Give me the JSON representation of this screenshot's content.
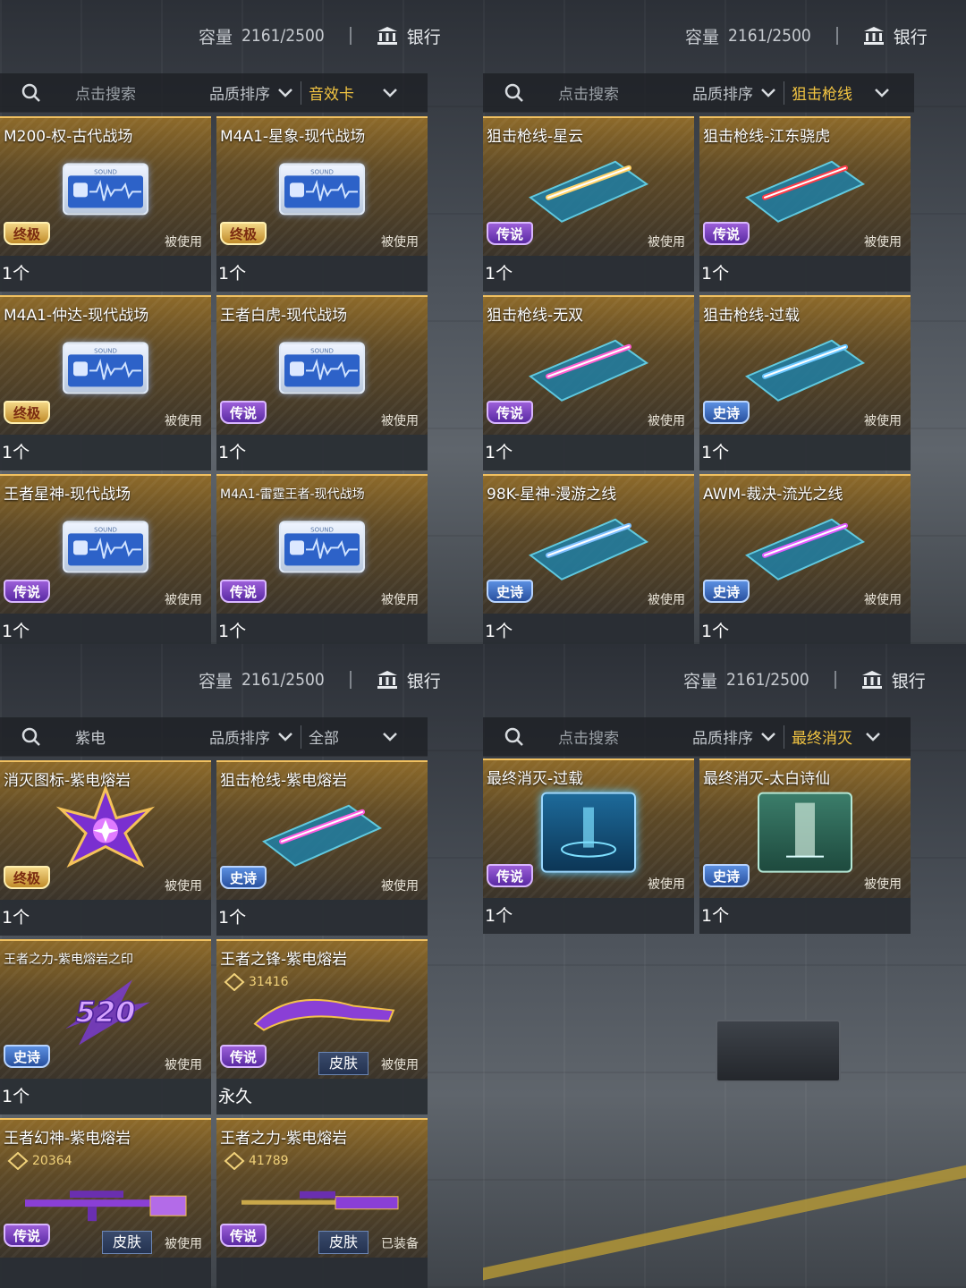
{
  "panels": [
    {
      "capacity_label": "容量",
      "capacity_value": "2161/2500",
      "bank_label": "银行",
      "search_text": "点击搜索",
      "sort_label": "品质排序",
      "filter_value": "音效卡",
      "items": [
        {
          "title": "M200-权-古代战场",
          "rarity": "终极",
          "used": "被使用",
          "count": "1个",
          "img": "sound"
        },
        {
          "title": "M4A1-星象-现代战场",
          "rarity": "终极",
          "used": "被使用",
          "count": "1个",
          "img": "sound"
        },
        {
          "title": "M4A1-仲达-现代战场",
          "rarity": "终极",
          "used": "被使用",
          "count": "1个",
          "img": "sound"
        },
        {
          "title": "王者白虎-现代战场",
          "rarity": "传说",
          "used": "被使用",
          "count": "1个",
          "img": "sound"
        },
        {
          "title": "王者星神-现代战场",
          "rarity": "传说",
          "used": "被使用",
          "count": "1个",
          "img": "sound"
        },
        {
          "title": "M4A1-雷霆王者-现代战场",
          "rarity": "传说",
          "used": "被使用",
          "count": "1个",
          "img": "sound",
          "small": true
        }
      ]
    },
    {
      "capacity_label": "容量",
      "capacity_value": "2161/2500",
      "bank_label": "银行",
      "search_text": "点击搜索",
      "sort_label": "品质排序",
      "filter_value": "狙击枪线",
      "items": [
        {
          "title": "狙击枪线-星云",
          "rarity": "传说",
          "used": "被使用",
          "count": "1个",
          "img": "trail",
          "color": "#ffd36a"
        },
        {
          "title": "狙击枪线-江东骁虎",
          "rarity": "传说",
          "used": "被使用",
          "count": "1个",
          "img": "trail",
          "color": "#ff3d4a"
        },
        {
          "title": "狙击枪线-无双",
          "rarity": "传说",
          "used": "被使用",
          "count": "1个",
          "img": "trail",
          "color": "#ff5fd0"
        },
        {
          "title": "狙击枪线-过载",
          "rarity": "史诗",
          "used": "被使用",
          "count": "1个",
          "img": "trail",
          "color": "#6cc8ff"
        },
        {
          "title": "98K-星神-漫游之线",
          "rarity": "史诗",
          "used": "被使用",
          "count": "1个",
          "img": "trail",
          "color": "#7fc0ff"
        },
        {
          "title": "AWM-裁决-流光之线",
          "rarity": "史诗",
          "used": "被使用",
          "count": "1个",
          "img": "trail",
          "color": "#e05cff"
        }
      ]
    },
    {
      "capacity_label": "容量",
      "capacity_value": "2161/2500",
      "bank_label": "银行",
      "search_text": "紫电",
      "sort_label": "品质排序",
      "filter_value": "全部",
      "items": [
        {
          "title": "消灭图标-紫电熔岩",
          "rarity": "终极",
          "used": "被使用",
          "count": "1个",
          "img": "emblem"
        },
        {
          "title": "狙击枪线-紫电熔岩",
          "rarity": "史诗",
          "used": "被使用",
          "count": "1个",
          "img": "trail",
          "color": "#ff5ce0"
        },
        {
          "title": "王者之力-紫电熔岩之印",
          "rarity": "史诗",
          "used": "被使用",
          "count": "1个",
          "img": "spray",
          "small": true,
          "spray_text": "520"
        },
        {
          "title": "王者之锋-紫电熔岩",
          "rarity": "传说",
          "used": "被使用",
          "count": "永久",
          "img": "knife",
          "code": "31416",
          "skin": "皮肤"
        },
        {
          "title": "王者幻神-紫电熔岩",
          "rarity": "传说",
          "used": "被使用",
          "count": "",
          "img": "rifle",
          "code": "20364",
          "skin": "皮肤"
        },
        {
          "title": "王者之力-紫电熔岩",
          "rarity": "传说",
          "used": "已装备",
          "count": "",
          "img": "sniper",
          "code": "41789",
          "skin": "皮肤"
        }
      ]
    },
    {
      "capacity_label": "容量",
      "capacity_value": "2161/2500",
      "bank_label": "银行",
      "search_text": "点击搜索",
      "sort_label": "品质排序",
      "filter_value": "最终消灭",
      "items": [
        {
          "title": "最终消灭-过载",
          "rarity": "传说",
          "used": "被使用",
          "count": "1个",
          "img": "finalblue"
        },
        {
          "title": "最终消灭-太白诗仙",
          "rarity": "史诗",
          "used": "被使用",
          "count": "1个",
          "img": "finalgreen"
        }
      ]
    }
  ],
  "colors": {
    "accent_gold": "#f0c060",
    "filter_active": "#f3c542",
    "legend_purple": "#7b44c4",
    "epic_blue": "#3a6cc4",
    "ultimate_gold": "#d8a744"
  }
}
